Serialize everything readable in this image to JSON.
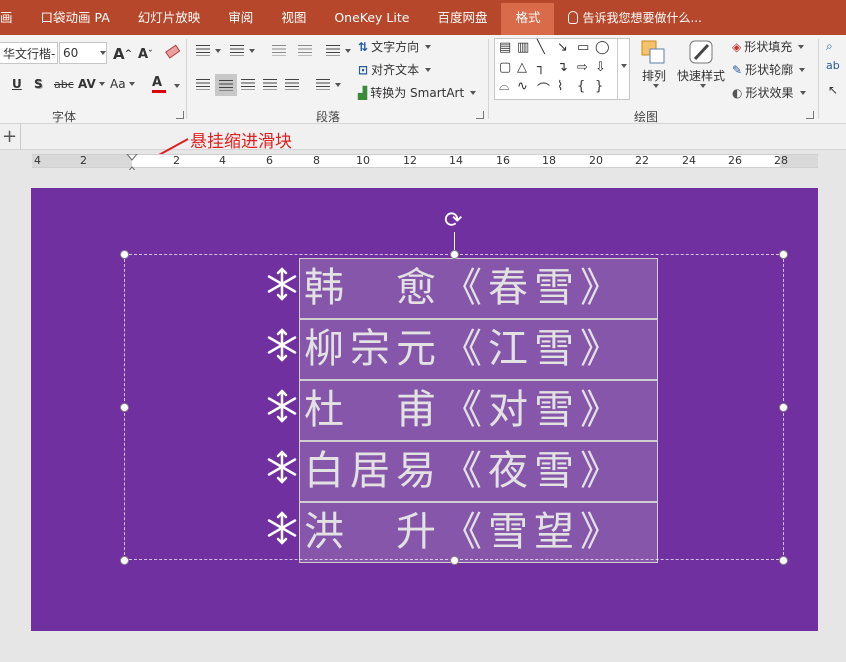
{
  "tabs": [
    {
      "label": "画",
      "active": false
    },
    {
      "label": "口袋动画 PA",
      "active": false
    },
    {
      "label": "幻灯片放映",
      "active": false
    },
    {
      "label": "审阅",
      "active": false
    },
    {
      "label": "视图",
      "active": false
    },
    {
      "label": "OneKey Lite",
      "active": false
    },
    {
      "label": "百度网盘",
      "active": false
    },
    {
      "label": "格式",
      "active": true
    }
  ],
  "tell_me": "告诉我您想要做什么...",
  "font": {
    "name": "华文行楷-",
    "size": "60",
    "group_label": "字体",
    "grow": "A",
    "shrink": "A",
    "underline": "U",
    "shadow": "S",
    "strike": "abc",
    "spacing": "AV",
    "case": "Aa",
    "color_letter": "A"
  },
  "paragraph": {
    "group_label": "段落",
    "text_direction": "文字方向",
    "align_text": "对齐文本",
    "smartart": "转换为 SmartArt"
  },
  "drawing": {
    "group_label": "绘图",
    "arrange": "排列",
    "quick_styles": "快速样式",
    "fill": "形状填充",
    "outline": "形状轮廓",
    "effects": "形状效果"
  },
  "annotation": "悬挂缩进滑块",
  "ruler": {
    "labels": [
      "4",
      "2",
      "2",
      "4",
      "6",
      "8",
      "10",
      "12",
      "14",
      "16",
      "18",
      "20",
      "22",
      "24",
      "26",
      "28"
    ]
  },
  "poem_lines": [
    "韩　愈《春雪》",
    "柳宗元《江雪》",
    "杜　甫《对雪》",
    "白居易《夜雪》",
    "洪　升《雪望》"
  ],
  "colors": {
    "tab_bar": "#b7472a",
    "slide_bg": "#7030a0",
    "annotation": "#e02020"
  }
}
